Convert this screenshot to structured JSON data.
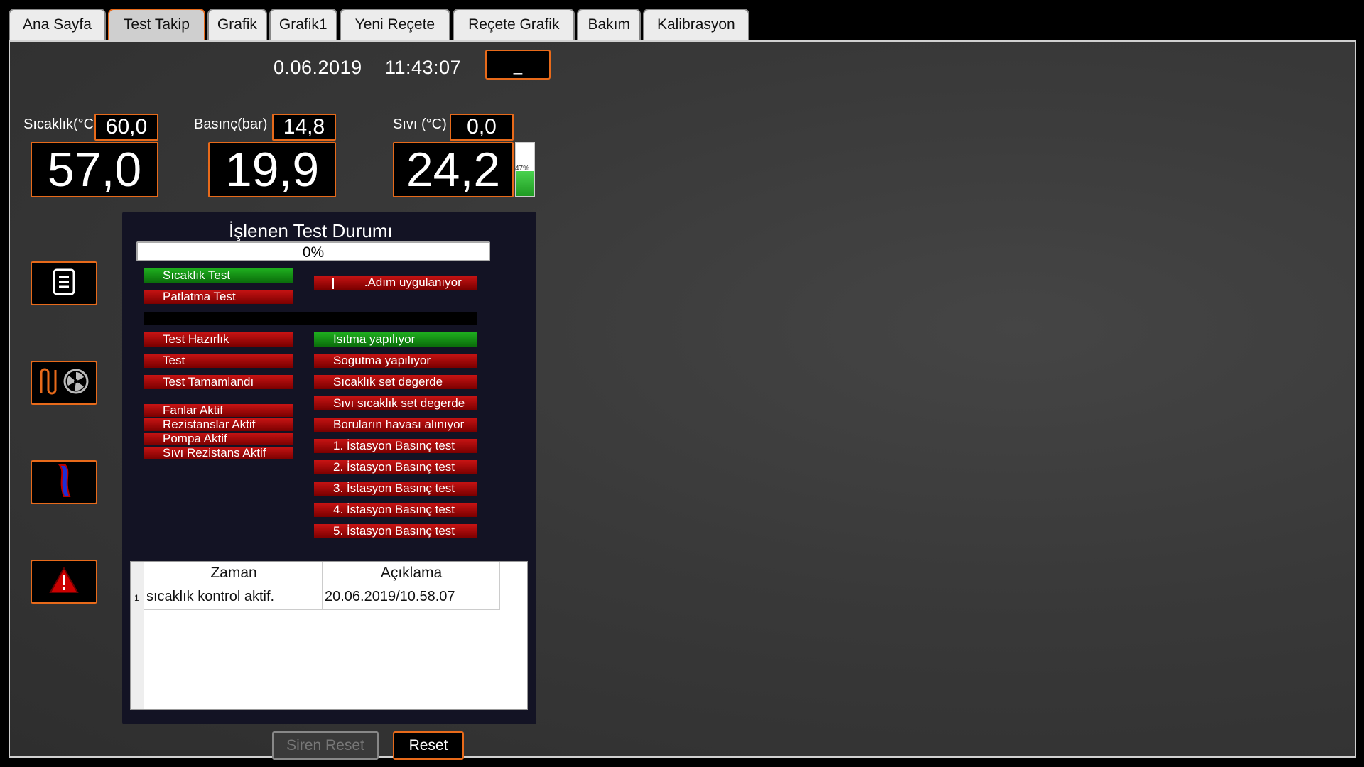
{
  "tabs": [
    "Ana Sayfa",
    "Test Takip",
    "Grafik",
    "Grafik1",
    "Yeni Reçete",
    "Reçete Grafik",
    "Bakım",
    "Kalibrasyon"
  ],
  "active_tab": "Test Takip",
  "header": {
    "date": "0.06.2019",
    "time": "11:43:07",
    "dash_button": "_"
  },
  "gauges": {
    "temperature": {
      "label": "Sıcaklık(°C",
      "set": "60,0",
      "value": "57,0"
    },
    "pressure": {
      "label": "Basınç(bar)",
      "set": "14,8",
      "value": "19,9"
    },
    "liquid": {
      "label": "Sıvı (°C)",
      "set": "0,0",
      "value": "24,2"
    }
  },
  "liquid_level": {
    "percent": 47,
    "label": "47%"
  },
  "side_buttons": [
    "document-icon",
    "heater-fan-icon",
    "pipe-icon",
    "warning-icon"
  ],
  "panel": {
    "title": "İşlenen Test Durumı",
    "progress": {
      "percent": 0,
      "label": "0%"
    },
    "test_types": [
      {
        "label": "Sıcaklık Test",
        "state": "green"
      },
      {
        "label": "Patlatma Test",
        "state": "red"
      }
    ],
    "step_label": ".Adım uygulanıyor",
    "phases": [
      {
        "label": "Test Hazırlık",
        "state": "red"
      },
      {
        "label": "Test",
        "state": "red"
      },
      {
        "label": "Test  Tamamlandı",
        "state": "red"
      }
    ],
    "actuators": [
      {
        "label": "Fanlar Aktif",
        "state": "red"
      },
      {
        "label": "Rezistanslar Aktif",
        "state": "red"
      },
      {
        "label": "Pompa Aktif",
        "state": "red"
      },
      {
        "label": "Sıvı Rezistans Aktif",
        "state": "red"
      }
    ],
    "statuses": [
      {
        "label": "Isıtma yapılıyor",
        "state": "green"
      },
      {
        "label": "Sogutma yapılıyor",
        "state": "red"
      },
      {
        "label": "Sıcaklık set degerde",
        "state": "red"
      },
      {
        "label": "Sıvı sıcaklık set degerde",
        "state": "red"
      },
      {
        "label": "Boruların havası alınıyor",
        "state": "red"
      },
      {
        "label": "1. İstasyon Basınç test",
        "state": "red"
      },
      {
        "label": "2. İstasyon Basınç test",
        "state": "red"
      },
      {
        "label": "3. İstasyon Basınç test",
        "state": "red"
      },
      {
        "label": "4. İstasyon Basınç test",
        "state": "red"
      },
      {
        "label": "5. İstasyon Basınç test",
        "state": "red"
      }
    ]
  },
  "log": {
    "headers": [
      "Zaman",
      "Açıklama"
    ],
    "rows": [
      {
        "num": "1",
        "col1": "sıcaklık kontrol aktif.",
        "col2": "20.06.2019/10.58.07"
      }
    ]
  },
  "buttons": {
    "siren_reset": "Siren Reset",
    "reset": "Reset"
  },
  "colors": {
    "accent": "#e86a1a",
    "active_green": "#1fae1f",
    "inactive_red": "#b00000"
  }
}
